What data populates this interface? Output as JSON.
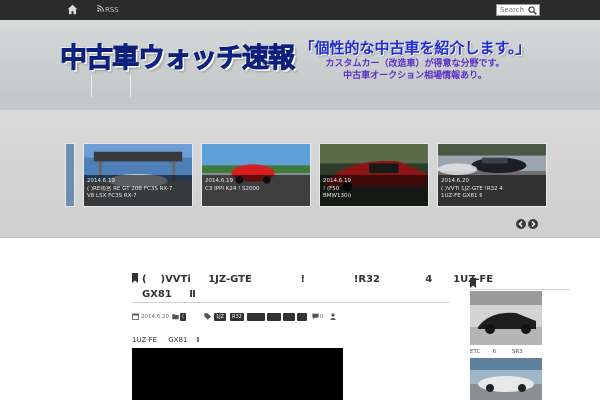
{
  "topbar": {
    "home_icon": "home-icon",
    "rss_label": "RSS",
    "search_placeholder": "Search"
  },
  "header": {
    "site_title": "中古車ウォッチ速報",
    "tagline_main": "「個性的な中古車を紹介します。」",
    "tagline_sub1": "カスタムカー（改造車）が得意な分野です。",
    "tagline_sub2": "中古車オークション相場情報あり。"
  },
  "slider": {
    "slides": [
      {
        "date": "2014.6.19",
        "line1": "( )RE雨宮 RE GT      20B      FC3S RX-7",
        "line2": "V8 LSX      FC3S RX-7"
      },
      {
        "date": "2014.6.19",
        "line1": "C3         IPPI       K24      !  S2000",
        "line2": ""
      },
      {
        "date": "2014.6.19",
        "line1": "        !         (F50",
        "line2": "BMW130i)"
      },
      {
        "date": "2014.6.20",
        "line1": "(  )VVTi  1JZ-GTE      !R32       4",
        "line2": "1UZ-FE     GX81    Ⅱ"
      }
    ],
    "prev_icon": "chevron-left-icon",
    "next_icon": "chevron-right-icon"
  },
  "post": {
    "title_line1": "(    )VVTi     1JZ-GTE              !              !R32             4      1UZ-FE",
    "title_line2": "GX81     Ⅱ",
    "date": "2014.6.20",
    "category": "(   )",
    "tags": [
      "1JZ",
      "R32",
      "",
      "",
      "",
      ""
    ],
    "comments": "0",
    "lead": "1UZ-FE     GX81    Ⅱ"
  },
  "sidebar": {
    "caption": "ETC       6         SR3"
  }
}
